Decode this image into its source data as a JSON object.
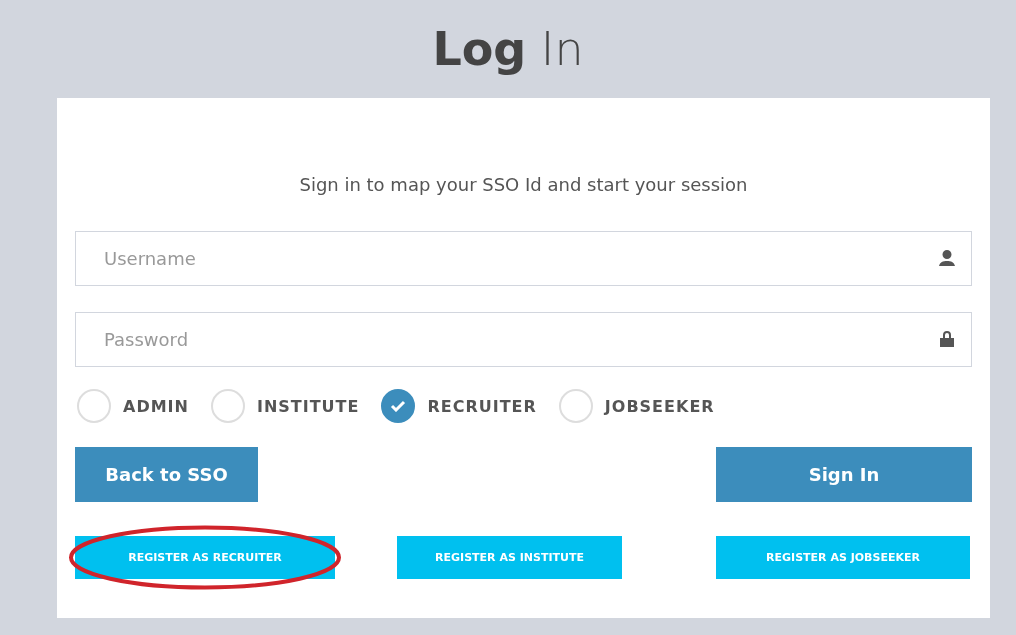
{
  "title": "**Log** In",
  "subtitle": "Sign in to map your SSO Id and start your session",
  "fields": [
    {
      "kind": "user",
      "placeholder": "Username"
    },
    {
      "kind": "lock",
      "placeholder": "Password"
    }
  ],
  "roles": [
    {
      "label": "ADMIN",
      "selected": false
    },
    {
      "label": "INSTITUTE",
      "selected": false
    },
    {
      "label": "RECRUITER",
      "selected": true
    },
    {
      "label": "JOBSEEKER",
      "selected": false
    }
  ],
  "back_button": "Back to SSO",
  "sign_in_button": "Sign In",
  "register_buttons": [
    {
      "label": "REGISTER AS RECRUITER",
      "highlighted": true
    },
    {
      "label": "REGISTER AS INSTITUTE",
      "highlighted": false
    },
    {
      "label": "REGISTER AS JOBSEEKER",
      "highlighted": false
    }
  ]
}
